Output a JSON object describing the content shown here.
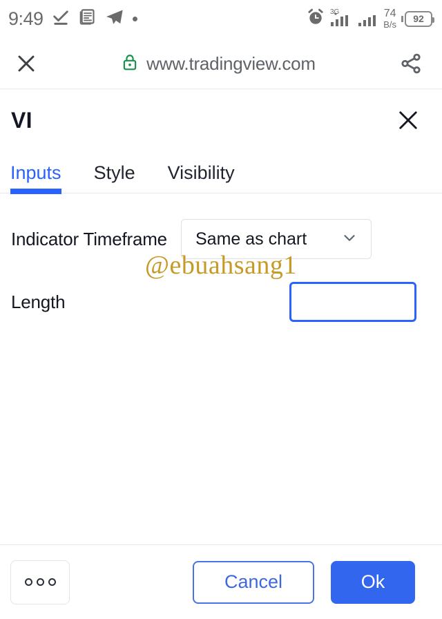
{
  "status_bar": {
    "time": "9:49",
    "icons_left": [
      "checkmark-underline-icon",
      "news-document-icon",
      "telegram-icon",
      "dot-indicator"
    ],
    "network_type": "3G",
    "data_speed_value": "74",
    "data_speed_unit": "B/s",
    "battery_percent": "92"
  },
  "browser": {
    "close_label": "close-icon",
    "lock_label": "secure-lock-icon",
    "url": "www.tradingview.com",
    "share_label": "share-icon"
  },
  "dialog": {
    "title": "VI",
    "close_label": "close-icon",
    "tabs": [
      {
        "label": "Inputs",
        "active": true
      },
      {
        "label": "Style",
        "active": false
      },
      {
        "label": "Visibility",
        "active": false
      }
    ],
    "fields": {
      "timeframe": {
        "label": "Indicator Timeframe",
        "value": "Same as chart",
        "placeholder": "Same as chart"
      },
      "length": {
        "label": "Length",
        "value": "",
        "placeholder": ""
      }
    },
    "watermark": "@ebuahsang1",
    "footer": {
      "more_label": "ooo",
      "cancel_label": "Cancel",
      "ok_label": "Ok"
    }
  },
  "colors": {
    "accent_blue": "#2962ff",
    "ok_button": "#3366ee",
    "lock_green": "#17924a",
    "watermark_gold": "#c79a28"
  }
}
